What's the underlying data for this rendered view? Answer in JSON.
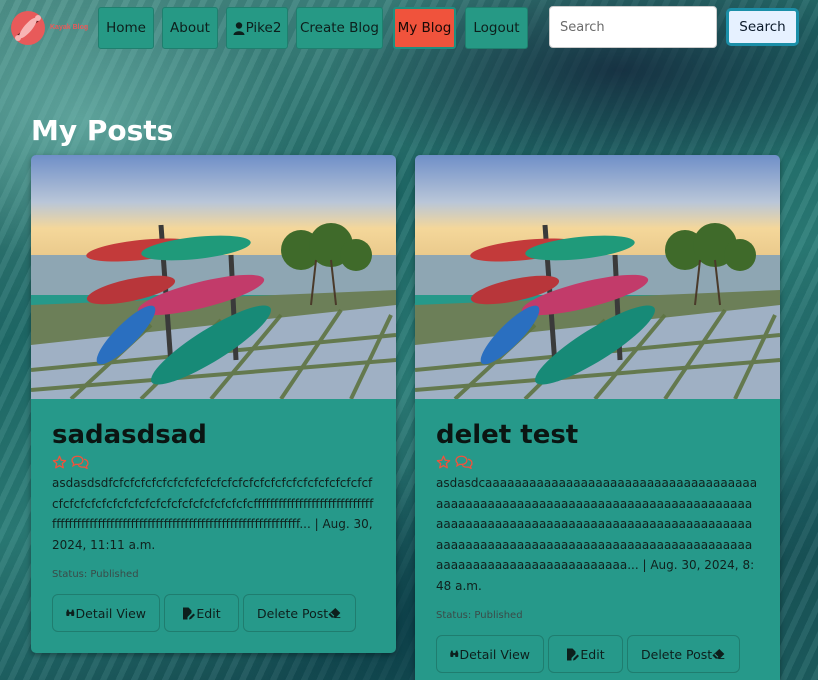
{
  "nav": {
    "logo_text": "Kayak Blog",
    "home": "Home",
    "about": "About",
    "user": "Pike2",
    "create": "Create Blog",
    "my_blog": "My Blog",
    "logout": "Logout",
    "search_placeholder": "Search",
    "search_button": "Search"
  },
  "page": {
    "title": "My Posts"
  },
  "posts": [
    {
      "title": "sadasdsad",
      "excerpt": "asdasdsdfcfcfcfcfcfcfcfcfcfcfcfcfcfcfcfcfcfcfcfcfcfcfcfcfcfcfcfcfcfcfcfcfcfcfcfcfcfcfcfcfcfcfcfffffffffffffffffffffffffffffffffffffffffffffffffffffffffffffffffffffffffffffffffffffffff...",
      "date": "Aug. 30, 2024, 11:11 a.m.",
      "status": "Status: Published",
      "detail": "Detail View",
      "edit": "Edit",
      "delete": "Delete Post"
    },
    {
      "title": "delet test",
      "excerpt": "asdasdcaaaaaaaaaaaaaaaaaaaaaaaaaaaaaaaaaaaaaaaaaaaaaaaaaaaaaaaaaaaaaaaaaaaaaaaaaaaaaaaaaaaaaaaaaaaaaaaaaaaaaaaaaaaaaaaaaaaaaaaaaaaaaaaaaaaaaaaaaaaaaaaaaaaaaaaaaaaaaaaaaaaaaaaaaaaaaaaaaaaaaaaaaaaaaaaa...",
      "date": "Aug. 30, 2024, 8:48 a.m.",
      "status": "Status: Published",
      "detail": "Detail View",
      "edit": "Edit",
      "delete": "Delete Post"
    }
  ],
  "colors": {
    "accent": "#269985",
    "active": "#f0533c",
    "logo": "#e85a5a"
  },
  "icons": {
    "user": "user-icon",
    "star": "star-outline-icon",
    "comments": "comments-outline-icon",
    "detail": "binoculars-icon",
    "edit": "file-pen-icon",
    "delete": "eraser-icon"
  }
}
